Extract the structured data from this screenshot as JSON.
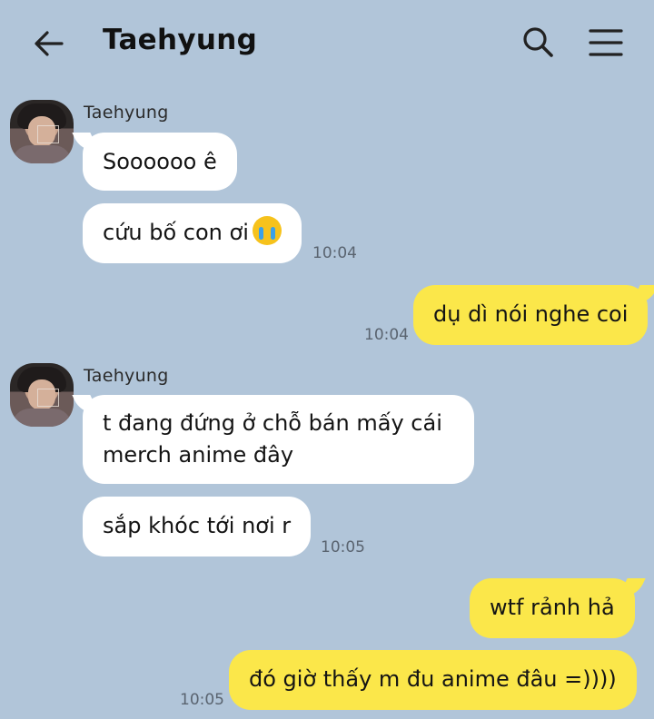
{
  "header": {
    "title": "Taehyung",
    "back_icon": "back-arrow-icon",
    "search_icon": "search-icon",
    "menu_icon": "hamburger-menu-icon"
  },
  "messages": [
    {
      "sender": "Taehyung",
      "text": "Soooooo ê",
      "from": "them"
    },
    {
      "text": "cứu bố con ơi",
      "emoji": "loudly-crying-face",
      "time": "10:04",
      "from": "them"
    },
    {
      "text": "dụ dì nói nghe coi",
      "time": "10:04",
      "from": "me"
    },
    {
      "sender": "Taehyung",
      "text_line1": "t đang đứng ở chỗ bán mấy cái",
      "text_line2": "merch anime đây",
      "from": "them"
    },
    {
      "text": "sắp khóc tới nơi r",
      "time": "10:05",
      "from": "them"
    },
    {
      "text": "wtf rảnh hả",
      "from": "me"
    },
    {
      "text": "đó giờ thấy m đu anime đâu =))))",
      "time": "10:05",
      "from": "me"
    }
  ],
  "colors": {
    "background": "#b1c5d9",
    "incoming_bubble": "#ffffff",
    "outgoing_bubble": "#fbe74a"
  }
}
